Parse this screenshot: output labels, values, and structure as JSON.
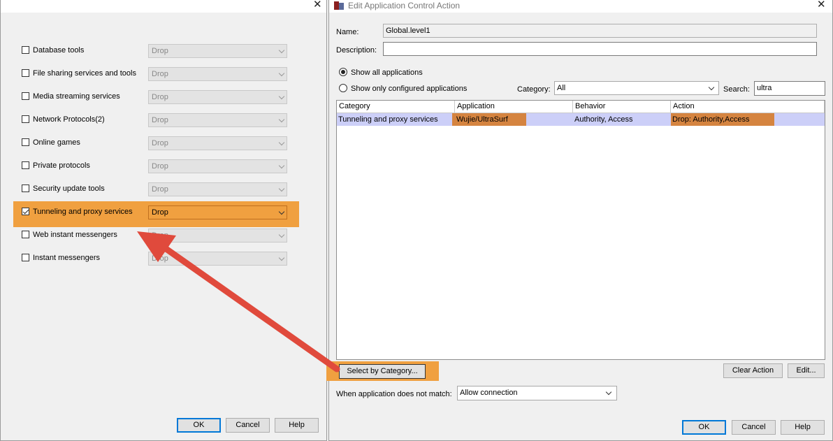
{
  "left_dialog": {
    "close_glyph": "✕",
    "categories": [
      {
        "label": "Database tools",
        "checked": false,
        "action": "Drop"
      },
      {
        "label": "File sharing services and tools",
        "checked": false,
        "action": "Drop"
      },
      {
        "label": "Media streaming services",
        "checked": false,
        "action": "Drop"
      },
      {
        "label": "Network Protocols(2)",
        "checked": false,
        "action": "Drop"
      },
      {
        "label": "Online games",
        "checked": false,
        "action": "Drop"
      },
      {
        "label": "Private protocols",
        "checked": false,
        "action": "Drop"
      },
      {
        "label": "Security update tools",
        "checked": false,
        "action": "Drop"
      },
      {
        "label": "Tunneling and proxy services",
        "checked": true,
        "action": "Drop"
      },
      {
        "label": "Web instant messengers",
        "checked": false,
        "action": "Drop"
      },
      {
        "label": "Instant messengers",
        "checked": false,
        "action": "Drop"
      }
    ],
    "buttons": {
      "ok": "OK",
      "cancel": "Cancel",
      "help": "Help"
    }
  },
  "right_dialog": {
    "title": "Edit Application Control Action",
    "close_glyph": "✕",
    "name_label": "Name:",
    "name_value": "Global.level1",
    "description_label": "Description:",
    "description_value": "",
    "radio_all": "Show all applications",
    "radio_configured": "Show only configured applications",
    "category_label": "Category:",
    "category_value": "All",
    "search_label": "Search:",
    "search_value": "ultra",
    "table": {
      "headers": [
        "Category",
        "Application",
        "Behavior",
        "Action"
      ],
      "rows": [
        {
          "category": "Tunneling and proxy services",
          "application": "Wujie/UltraSurf",
          "behavior": "Authority, Access",
          "action": "Drop: Authority,Access"
        }
      ]
    },
    "select_by_category": "Select by Category...",
    "clear_action": "Clear Action",
    "edit": "Edit...",
    "no_match_label": "When application does not match:",
    "no_match_value": "Allow connection",
    "buttons": {
      "ok": "OK",
      "cancel": "Cancel",
      "help": "Help"
    }
  },
  "colors": {
    "highlight": "#f0a040",
    "selected_row": "#cccff8",
    "cell_highlight": "#d58440",
    "arrow": "#e04a3c"
  }
}
